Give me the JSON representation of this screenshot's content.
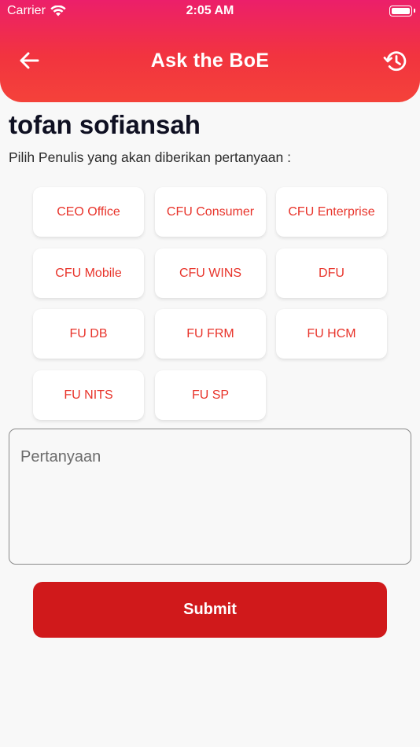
{
  "status_bar": {
    "carrier": "Carrier",
    "time": "2:05 AM"
  },
  "header": {
    "title": "Ask the BoE",
    "back_icon": "arrow-left-icon",
    "history_icon": "history-icon",
    "gradient_colors": [
      "#ec1f6a",
      "#f4423a"
    ]
  },
  "user": {
    "name": "tofan sofiansah"
  },
  "instruction": "Pilih Penulis yang akan diberikan pertanyaan :",
  "writers": [
    "CEO Office",
    "CFU Consumer",
    "CFU Enterprise",
    "CFU Mobile",
    "CFU WINS",
    "DFU",
    "FU DB",
    "FU FRM",
    "FU HCM",
    "FU NITS",
    "FU SP"
  ],
  "question": {
    "placeholder": "Pertanyaan",
    "value": ""
  },
  "submit_label": "Submit",
  "colors": {
    "accent": "#e8332a",
    "submit": "#d0191b",
    "background": "#f8f8f8"
  }
}
